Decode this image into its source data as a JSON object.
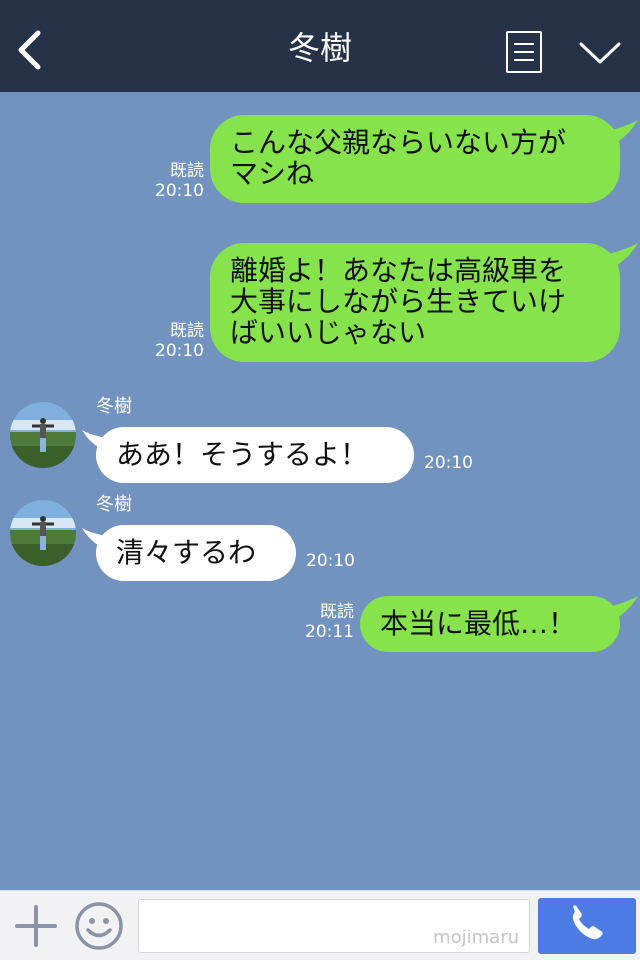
{
  "header": {
    "title": "冬樹",
    "back_icon": "chevron-left-icon",
    "menu_icon": "menu-list-icon",
    "collapse_icon": "chevron-down-icon"
  },
  "messages": [
    {
      "direction": "sent",
      "text_lines": [
        "こんな父親ならいない方が",
        "マシね"
      ],
      "read_label": "既読",
      "time": "20:10"
    },
    {
      "direction": "sent",
      "text_lines": [
        "離婚よ！あなたは高級車を",
        "大事にしながら生きていけ",
        "ばいいじゃない"
      ],
      "read_label": "既読",
      "time": "20:10"
    },
    {
      "direction": "received",
      "sender": "冬樹",
      "text": "ああ！そうするよ！",
      "time": "20:10"
    },
    {
      "direction": "received",
      "sender": "冬樹",
      "text": "清々するわ",
      "time": "20:10"
    },
    {
      "direction": "sent",
      "text": "本当に最低…！",
      "read_label": "既読",
      "time": "20:11"
    }
  ],
  "input_bar": {
    "value": "",
    "watermark": "mojimaru",
    "plus_icon": "plus-icon",
    "emoji_icon": "smiley-icon",
    "call_icon": "phone-icon"
  },
  "colors": {
    "header_bg": "#263248",
    "chat_bg": "#7292c0",
    "sent_bubble": "#86e34b",
    "received_bubble": "#ffffff",
    "call_button": "#4c7be4"
  }
}
